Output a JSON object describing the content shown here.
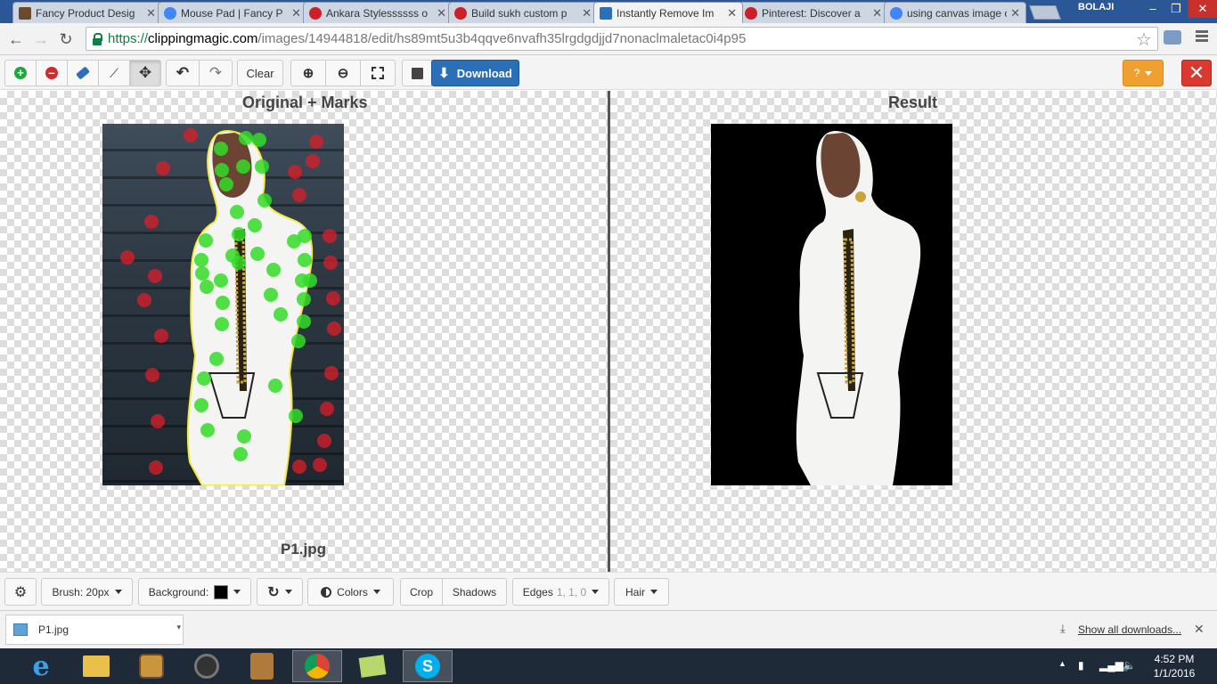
{
  "browser": {
    "tabs": [
      {
        "title": "Fancy Product Desig",
        "color": "#6b4a2f"
      },
      {
        "title": "Mouse Pad | Fancy P",
        "color": "#4285f4"
      },
      {
        "title": "Ankara Stylessssss o",
        "color": "#cb2027"
      },
      {
        "title": "Build sukh custom p",
        "color": "#cb2027"
      },
      {
        "title": "Instantly Remove Im",
        "color": "#2a6fb7"
      },
      {
        "title": "Pinterest: Discover a",
        "color": "#cb2027"
      },
      {
        "title": "using canvas image c",
        "color": "#4285f4"
      }
    ],
    "profile": "BOLAJI",
    "url": {
      "proto": "https://",
      "host": "clippingmagic.com",
      "path": "/images/14944818/edit/hs89mt5u3b4qqve6nvafh35lrgdgdjjd7nonaclmaletac0i4p95"
    }
  },
  "toolbar": {
    "clear_label": "Clear",
    "download_label": "Download",
    "help_label": "?",
    "colors": {
      "download": "#2a6fb7",
      "help": "#f0a030",
      "close": "#d9392e",
      "add": "#1fa83a",
      "remove": "#d42a2a"
    }
  },
  "editor": {
    "left_title": "Original + Marks",
    "right_title": "Result",
    "filename": "P1.jpg"
  },
  "bottom": {
    "brush_label": "Brush: 20px",
    "background_label": "Background:",
    "background_color": "#000000",
    "colors_label": "Colors",
    "crop_label": "Crop",
    "shadows_label": "Shadows",
    "edges_label": "Edges",
    "edges_values": "1, 1, 0",
    "hair_label": "Hair"
  },
  "downloads": {
    "item_name": "P1.jpg",
    "show_all": "Show all downloads..."
  },
  "taskbar": {
    "time": "4:52 PM",
    "date": "1/1/2016"
  }
}
